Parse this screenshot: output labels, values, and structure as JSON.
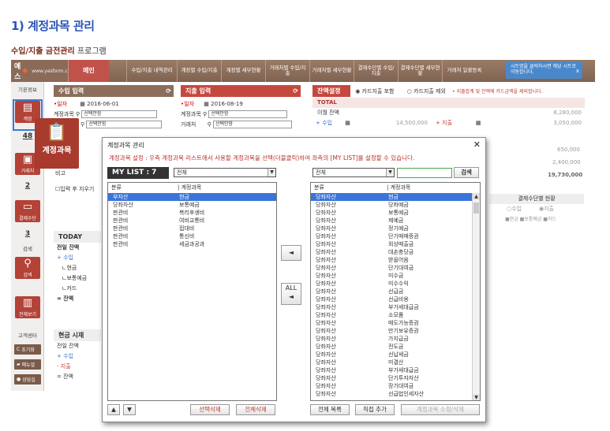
{
  "heading": "1) 계정과목 관리",
  "subheading": {
    "bold": "수입/지출 금전관리",
    "rest": " 프로그램"
  },
  "navbar": {
    "logo": "예스",
    "logo_site": "www.yesform.com",
    "items": [
      "메인",
      "수입/지출 내역관리",
      "계정별 수입/지출",
      "계정별 세부현황",
      "거래처별 수입/지출",
      "거래처별 세부현황",
      "결제수단별 수입/지출",
      "결제수단별 세부현황",
      "거래처 일괄등록"
    ]
  },
  "tooltip": {
    "text": "시트명을 클릭하시면 해당 시트로 이동합니다.",
    "close": "x"
  },
  "sidebar": {
    "basic": "기본정보",
    "btn1": "계정",
    "num1": "1",
    "num48": "48",
    "btn2": "거래처",
    "num2": "2",
    "btn_pay": "결제수단",
    "num3": "3",
    "search_lbl": "검색",
    "btn_search": "검색",
    "btn_all": "전체보기",
    "center": "고객센터",
    "init": "초기화",
    "manual": "매뉴얼",
    "consult": "상담실"
  },
  "bigtip": "계정과목",
  "income": {
    "title": "수입 입력",
    "date_label": "•일자",
    "date": "2016-06-01",
    "acct_label": "계정과목",
    "acct_placeholder": "선택안함",
    "vendor_placeholder": "선택안함",
    "memo_label": "비고",
    "checkbox_label": "입력 후 지우기"
  },
  "expense": {
    "title": "지출 입력",
    "date_label": "•일자",
    "date": "2016-08-19",
    "acct_label": "계정과목",
    "acct_placeholder": "선택안함",
    "vendor_label": "거래처",
    "vendor_placeholder": "선택안함"
  },
  "balance": {
    "title": "잔액설정",
    "opt1": "카드지출 포함",
    "opt2": "카드지출 제외",
    "note": "• 지출합계 및 잔액에 카드금액을 제외합니다.",
    "total": "TOTAL",
    "carry": "이월 잔액",
    "carry_val": "8,280,000",
    "income_lbl": "+ 수입",
    "income_val": "14,500,000",
    "exp_lbl": "+ 지출",
    "exp_val": "3,050,000",
    "v1": "650,000",
    "v2": "2,400,000",
    "v3": "19,730,000"
  },
  "today": {
    "title": "TODAY",
    "prev": "전일 잔액",
    "income": "+ 수입",
    "cash": "ㄴ현금",
    "deposit": "ㄴ보통예금",
    "card": "ㄴ카드",
    "balance": "= 잔액"
  },
  "cash": {
    "title": "현금 시재",
    "prev": "전일 잔액",
    "income": "+ 수입",
    "exp": "- 지출",
    "bal": "= 잔액"
  },
  "paystatus": {
    "title": "결제수단별 현황",
    "opt1": "수입",
    "opt2": "지출",
    "legend": "■현금 ■보통예금 ■카드"
  },
  "modal": {
    "title": "계정과목 관리",
    "close": "✕",
    "desc": "계정과목 설정 : 우측 계정과목 리스트에서 사용할 계정과목을 선택(더블클릭)하여 좌측의 [MY LIST]를 설정할 수 있습니다.",
    "mylist_label": "MY LIST : 7",
    "left_filter": "전체",
    "right_filter": "전체",
    "search_btn": "검색",
    "col_cat": "분류",
    "col_acct": "| 계정과목",
    "left_items": [
      [
        "부자산",
        "현금"
      ],
      [
        "당좌자산",
        "보통예금"
      ],
      [
        "판관비",
        "복리후생비"
      ],
      [
        "판관비",
        "여비교통비"
      ],
      [
        "판관비",
        "접대비"
      ],
      [
        "판관비",
        "통신비"
      ],
      [
        "판관비",
        "세금과공과"
      ]
    ],
    "right_items": [
      [
        "당좌자산",
        "현금"
      ],
      [
        "당좌자산",
        "당좌예금"
      ],
      [
        "당좌자산",
        "보통예금"
      ],
      [
        "당좌자산",
        "제예금"
      ],
      [
        "당좌자산",
        "정기예금"
      ],
      [
        "당좌자산",
        "단기매매증권"
      ],
      [
        "당좌자산",
        "외상매출금"
      ],
      [
        "당좌자산",
        "대손충당금"
      ],
      [
        "당좌자산",
        "받을어음"
      ],
      [
        "당좌자산",
        "단기대여금"
      ],
      [
        "당좌자산",
        "미수금"
      ],
      [
        "당좌자산",
        "미수수익"
      ],
      [
        "당좌자산",
        "선급금"
      ],
      [
        "당좌자산",
        "선급비용"
      ],
      [
        "당좌자산",
        "부가세대급금"
      ],
      [
        "당좌자산",
        "소모품"
      ],
      [
        "당좌자산",
        "매도가능증권"
      ],
      [
        "당좌자산",
        "만기보유증권"
      ],
      [
        "당좌자산",
        "가지급금"
      ],
      [
        "당좌자산",
        "전도금"
      ],
      [
        "당좌자산",
        "선납세금"
      ],
      [
        "당좌자산",
        "미결산"
      ],
      [
        "당좌자산",
        "부가세대급금"
      ],
      [
        "당좌자산",
        "단기투자자산"
      ],
      [
        "당좌자산",
        "장기대여금"
      ],
      [
        "당좌자산",
        "선급법인세자산"
      ],
      [
        "당좌자산",
        "이연법인세자산"
      ],
      [
        "당좌자산",
        "특정현금과예금"
      ]
    ],
    "btn_up": "▲",
    "btn_down": "▼",
    "btn_del_sel": "선택삭제",
    "btn_del_all": "전체삭제",
    "btn_move_one": "◄",
    "btn_all_top": "ALL",
    "btn_all_arrow": "◄",
    "btn_list": "전체 목록",
    "btn_add": "직접 추가",
    "btn_edit": "계정과목 수정/삭제"
  }
}
